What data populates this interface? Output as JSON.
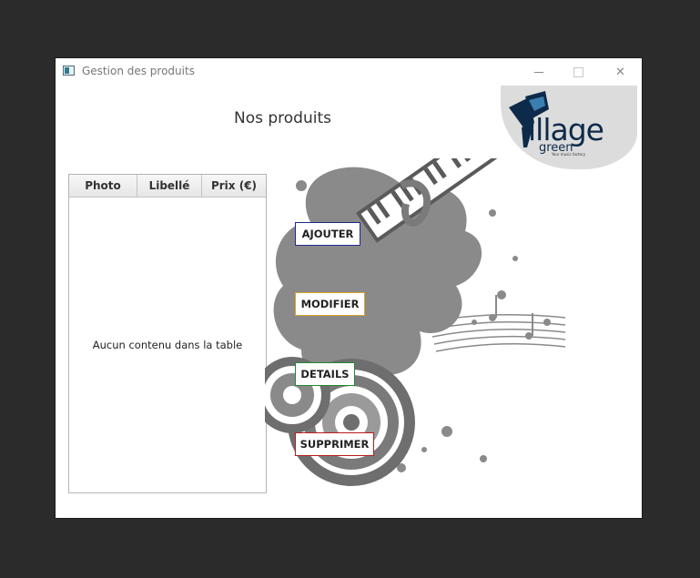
{
  "window": {
    "title": "Gestion des produits",
    "controls": {
      "minimize": "",
      "maximize": "",
      "close": "✕"
    }
  },
  "logo": {
    "word": "illage",
    "sub": "green",
    "tagline": "Your music factory",
    "colors": {
      "navy": "#0e2a4a",
      "accent": "#3a7fb0"
    }
  },
  "main": {
    "heading": "Nos produits"
  },
  "table": {
    "columns": [
      "Photo",
      "Libellé",
      "Prix (€)"
    ],
    "rows": [],
    "empty_message": "Aucun contenu dans la table"
  },
  "actions": {
    "add": {
      "label": "AJOUTER",
      "color": "#1f2a8c"
    },
    "modify": {
      "label": "MODIFIER",
      "color": "#d9a227"
    },
    "details": {
      "label": "DETAILS",
      "color": "#1f8a2e"
    },
    "delete": {
      "label": "SUPPRIMER",
      "color": "#b71c1c"
    }
  }
}
